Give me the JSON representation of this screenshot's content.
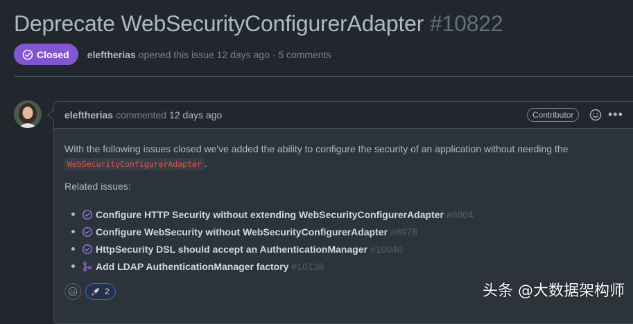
{
  "issue": {
    "title": "Deprecate WebSecurityConfigurerAdapter",
    "number": "#10822",
    "state": "Closed",
    "author": "eleftherias",
    "meta_text": "opened this issue 12 days ago · 5 comments"
  },
  "comment": {
    "author": "eleftherias",
    "action": "commented",
    "time": "12 days ago",
    "role_badge": "Contributor",
    "body_text": "With the following issues closed we've added the ability to configure the security of an application without needing the",
    "code": "WebSecurityConfigurerAdapter",
    "body_end": ".",
    "related_label": "Related issues:",
    "related_issues": [
      {
        "title": "Configure HTTP Security without extending WebSecurityConfigurerAdapter",
        "number": "#8804",
        "icon": "closed-issue-icon"
      },
      {
        "title": "Configure WebSecurity without WebSecurityConfigurerAdapter",
        "number": "#8978",
        "icon": "closed-issue-icon"
      },
      {
        "title": "HttpSecurity DSL should accept an AuthenticationManager",
        "number": "#10040",
        "icon": "closed-issue-icon"
      },
      {
        "title": "Add LDAP AuthenticationManager factory",
        "number": "#10138",
        "icon": "merged-pr-icon"
      }
    ],
    "reactions": {
      "emoji": "rocket-icon",
      "count": "2"
    }
  },
  "watermark": "头条 @大数据架构师",
  "colors": {
    "closed": "#8256d0",
    "accent_blue": "#316dca",
    "bg": "#22272e",
    "code_red": "#e5534b"
  }
}
